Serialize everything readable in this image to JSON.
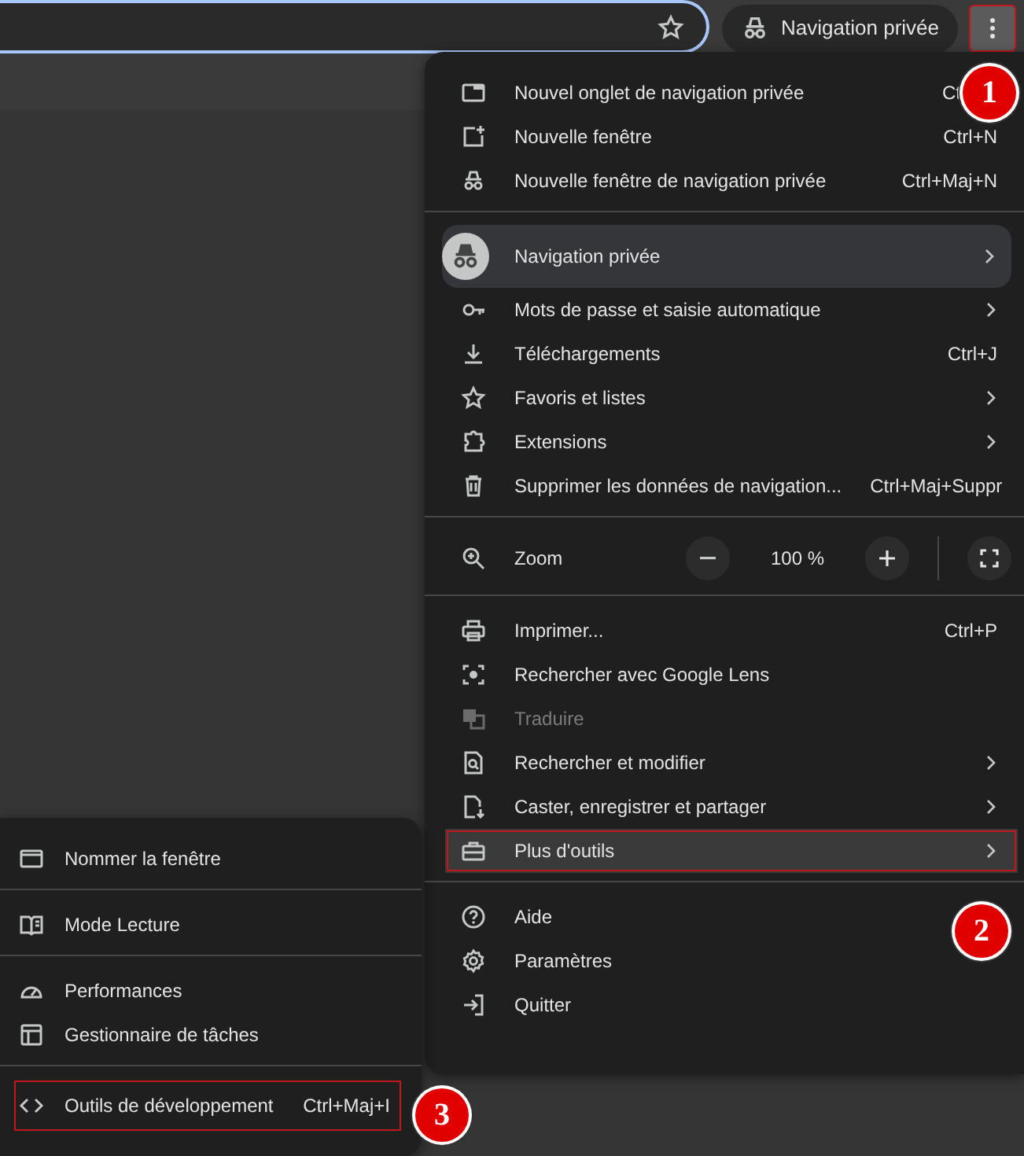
{
  "toolbar": {
    "profile_chip": "Navigation privée",
    "menu_button": {
      "highlighted": true
    }
  },
  "menu": {
    "sections": [
      {
        "items": [
          {
            "kind": "item",
            "label": "Nouvel onglet de navigation privée",
            "shortcut": "Ct",
            "selected": false
          },
          {
            "kind": "item",
            "label": "Nouvelle fenêtre",
            "shortcut": "Ctrl+N",
            "selected": false
          },
          {
            "kind": "item",
            "label": "Nouvelle fenêtre de navigation privée",
            "shortcut": "Ctrl+Maj+N",
            "selected": false
          }
        ]
      },
      {
        "items": [
          {
            "kind": "profile",
            "label": "Navigation privée",
            "submenu": true,
            "selected": false
          },
          {
            "kind": "item",
            "label": "Mots de passe et saisie automatique",
            "submenu": true,
            "selected": false
          },
          {
            "kind": "item",
            "label": "Téléchargements",
            "shortcut": "Ctrl+J",
            "selected": false
          },
          {
            "kind": "item",
            "label": "Favoris et listes",
            "submenu": true,
            "selected": false
          },
          {
            "kind": "item",
            "label": "Extensions",
            "submenu": true,
            "selected": false
          },
          {
            "kind": "item",
            "label": "Supprimer les données de navigation...",
            "shortcut": "Ctrl+Maj+Suppr",
            "selected": false
          }
        ]
      },
      {
        "items": [
          {
            "kind": "zoom",
            "label": "Zoom",
            "value": "100 %"
          }
        ]
      },
      {
        "items": [
          {
            "kind": "item",
            "label": "Imprimer...",
            "shortcut": "Ctrl+P",
            "selected": false
          },
          {
            "kind": "item",
            "label": "Rechercher avec Google Lens",
            "selected": false
          },
          {
            "kind": "item",
            "label": "Traduire",
            "disabled": true,
            "selected": false
          },
          {
            "kind": "item",
            "label": "Rechercher et modifier",
            "submenu": true,
            "selected": false
          },
          {
            "kind": "item",
            "label": "Caster, enregistrer et partager",
            "submenu": true,
            "selected": false
          },
          {
            "kind": "item",
            "label": "Plus d'outils",
            "submenu": true,
            "selected": true,
            "highlighted": true
          }
        ]
      },
      {
        "items": [
          {
            "kind": "item",
            "label": "Aide",
            "selected": false
          },
          {
            "kind": "item",
            "label": "Paramètres",
            "selected": false
          },
          {
            "kind": "item",
            "label": "Quitter",
            "selected": false
          }
        ]
      }
    ]
  },
  "submenu": {
    "sections": [
      {
        "items": [
          {
            "label": "Nommer la fenêtre"
          }
        ]
      },
      {
        "items": [
          {
            "label": "Mode Lecture"
          }
        ]
      },
      {
        "items": [
          {
            "label": "Performances"
          },
          {
            "label": "Gestionnaire de tâches"
          }
        ]
      },
      {
        "items": [
          {
            "label": "Outils de développement",
            "shortcut": "Ctrl+Maj+I",
            "highlighted": true
          }
        ]
      }
    ]
  },
  "callouts": [
    {
      "label": "1"
    },
    {
      "label": "2"
    },
    {
      "label": "3"
    }
  ]
}
